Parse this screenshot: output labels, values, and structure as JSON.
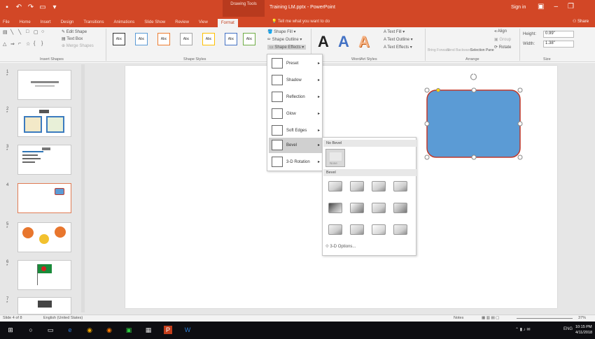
{
  "window": {
    "context_tab": "Drawing Tools",
    "title": "Training LM.pptx - PowerPoint",
    "user": "Sign in"
  },
  "tabs": [
    "File",
    "Home",
    "Insert",
    "Design",
    "Transitions",
    "Animations",
    "Slide Show",
    "Review",
    "View",
    "Format"
  ],
  "tell_me": "Tell me what you want to do",
  "share": "Share",
  "ribbon": {
    "edit_shape": "Edit Shape",
    "text_box": "Text Box",
    "merge_shapes": "Merge Shapes",
    "group_insert_shapes": "Insert Shapes",
    "group_shape_styles": "Shape Styles",
    "shape_fill": "Shape Fill",
    "shape_outline": "Shape Outline",
    "shape_effects": "Shape Effects",
    "wordart_letter": "A",
    "text_fill": "Text Fill",
    "text_outline": "Text Outline",
    "text_effects": "Text Effects",
    "group_wordart": "WordArt Styles",
    "bring_forward": "Bring Forward",
    "send_backward": "Send Backward",
    "selection_pane": "Selection Pane",
    "align": "Align",
    "group": "Group",
    "rotate": "Rotate",
    "group_arrange": "Arrange",
    "height_label": "Height:",
    "height_value": "0.99\"",
    "width_label": "Width:",
    "width_value": "1.38\"",
    "group_size": "Size",
    "swatch_text": "Abc"
  },
  "slides": [
    {
      "num": "1",
      "star": "*"
    },
    {
      "num": "2",
      "star": "*"
    },
    {
      "num": "3",
      "star": "*"
    },
    {
      "num": "4",
      "star": ""
    },
    {
      "num": "5",
      "star": "*"
    },
    {
      "num": "6",
      "star": "*"
    },
    {
      "num": "7",
      "star": "*"
    }
  ],
  "menu": {
    "items": [
      "Preset",
      "Shadow",
      "Reflection",
      "Glow",
      "Soft Edges",
      "Bevel",
      "3-D Rotation"
    ],
    "arrow": "▸"
  },
  "submenu": {
    "no_bevel": "No Bevel",
    "none_label": "None",
    "bevel": "Bevel",
    "options": "3-D Options..."
  },
  "status": {
    "slide_of": "Slide 4 of 8",
    "language": "English (United States)",
    "notes": "Notes",
    "zoom": "37%"
  },
  "taskbar": {
    "time": "10:15 PM",
    "date": "4/11/2018",
    "lang": "ENG"
  },
  "colors": {
    "accent": "#d24726",
    "shape_fill": "#5b9bd5",
    "shape_border": "#c0392b"
  }
}
